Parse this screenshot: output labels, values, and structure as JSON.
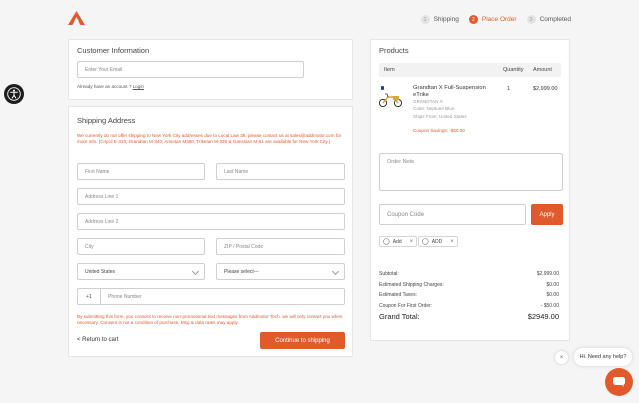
{
  "brand": {
    "logo_icon": "addmotor-logo-icon",
    "accent": "#e05a2b"
  },
  "steps": [
    {
      "num": "1",
      "label": "Shipping"
    },
    {
      "num": "2",
      "label": "Place Order"
    },
    {
      "num": "3",
      "label": "Completed"
    }
  ],
  "customer": {
    "title": "Customer Information",
    "email_placeholder": "Enter Your Email",
    "account_text": "Already have an account ?",
    "login_link": "Login"
  },
  "shipping": {
    "title": "Shipping Address",
    "notice": "We currently do not offer shipping to New York City addresses due to Local Law 39, please contact us at sales@addmotor.com for more info. (Citycil E-310, Grandtan M-340, Arisetan M360, Triketan M-330 & Ganssian M-61 are available for New York City.)",
    "first_name": "First Name",
    "last_name": "Last Name",
    "address1": "Address Line 1",
    "address2": "Address Line 2",
    "city": "City",
    "zip": "ZIP / Postal Code",
    "country": "United States",
    "state": "Please select---",
    "phone_prefix": "+1",
    "phone": "Phone Number",
    "consent": "By submitting this form, you consent to receive non-promotional text messages from Addmotor Tech. we will only contact you when necessary. Consent is not a condition of purchase. Msg & data rates may apply.",
    "return_link": "< Return to cart",
    "continue_btn": "Continue to shipping"
  },
  "products": {
    "title": "Products",
    "headers": {
      "item": "Item",
      "quantity": "Quantity",
      "amount": "Amount"
    },
    "item": {
      "name": "Grandtan X Full-Suspension eTrike",
      "sku": "GRANDTAN X",
      "color": "Color: Neptune Blue",
      "ships_from": "Ships From: United States",
      "coupon": "Coupon Savings: -$50.00",
      "quantity": "1",
      "amount": "$2,999.00"
    },
    "order_note_placeholder": "Order Note",
    "coupon_placeholder": "Coupon Code",
    "apply_btn": "Apply",
    "tags": [
      "Add",
      "ADD"
    ],
    "summary": {
      "subtotal_label": "Subtotal:",
      "subtotal": "$2,999.00",
      "shipping_label": "Estimated Shipping Charges:",
      "shipping": "$0.00",
      "taxes_label": "Estimated Taxes:",
      "taxes": "$0.00",
      "coupon_label": "Coupon For First Order:",
      "coupon": "- $50.00",
      "total_label": "Grand Total:",
      "total": "$2949.00"
    }
  },
  "chat": {
    "greeting": "Hi. Need any help?"
  }
}
